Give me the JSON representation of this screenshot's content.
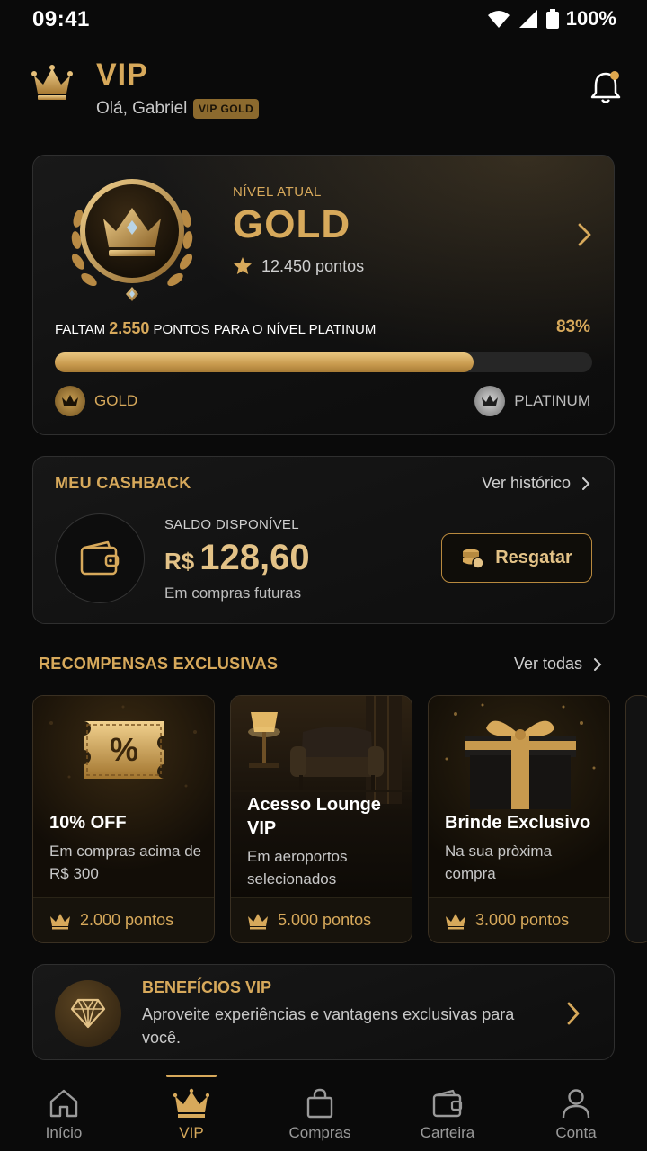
{
  "status_bar": {
    "time": "09:41",
    "battery": "100%"
  },
  "header": {
    "title": "VIP",
    "greeting": "Olá, Gabriel",
    "badge": "VIP GOLD"
  },
  "level": {
    "label": "NÍVEL ATUAL",
    "name": "GOLD",
    "points": "12.450 pontos",
    "progress_prefix": "FALTAM",
    "progress_amount": "2.550",
    "progress_suffix": "PONTOS PARA O NÍVEL PLATINUM",
    "percent_label": "83%",
    "progress_fraction": 0.78,
    "current_tier": "GOLD",
    "next_tier": "PLATINUM"
  },
  "cashback": {
    "title": "MEU CASHBACK",
    "history_link": "Ver histórico",
    "balance_label": "SALDO DISPONÍVEL",
    "currency": "R$",
    "amount": "128,60",
    "subtitle": "Em compras futuras",
    "redeem_label": "Resgatar"
  },
  "rewards": {
    "title": "RECOMPENSAS EXCLUSIVAS",
    "see_all": "Ver todas",
    "items": [
      {
        "title": "10% OFF",
        "desc": "Em compras acima de R$ 300",
        "points": "2.000 pontos",
        "icon": "discount-ticket-icon"
      },
      {
        "title": "Acesso Lounge VIP",
        "desc": "Em aeroportos selecionados",
        "points": "5.000 pontos",
        "icon": "lounge-armchair-image"
      },
      {
        "title": "Brinde Exclusivo",
        "desc": "Na sua pròxima compra",
        "points": "3.000 pontos",
        "icon": "gift-box-image"
      }
    ]
  },
  "benefits": {
    "title": "BENEFÍCIOS VIP",
    "text": "Aproveite experiências e vantagens exclusivas para você."
  },
  "nav": {
    "items": [
      {
        "label": "Início",
        "icon": "home-icon"
      },
      {
        "label": "VIP",
        "icon": "crown-icon"
      },
      {
        "label": "Compras",
        "icon": "shopping-bag-icon"
      },
      {
        "label": "Carteira",
        "icon": "wallet-icon"
      },
      {
        "label": "Conta",
        "icon": "user-icon"
      }
    ],
    "active": "VIP"
  },
  "colors": {
    "accent": "#d7a95b",
    "background": "#0a0a0a",
    "card": "#141414"
  }
}
